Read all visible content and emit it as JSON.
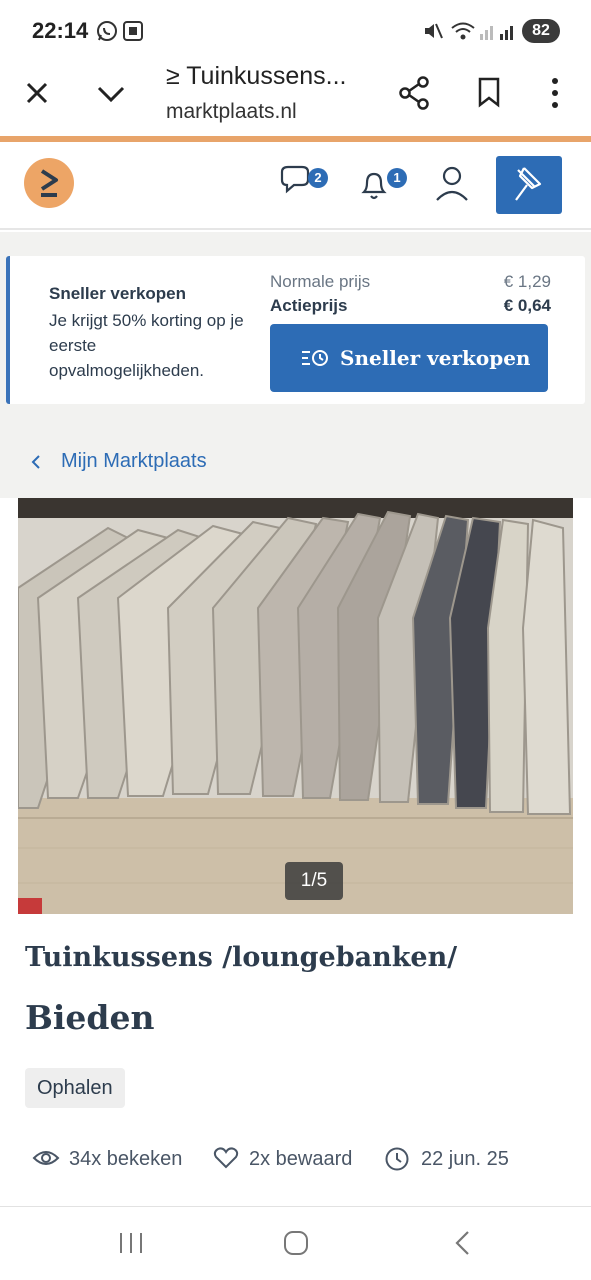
{
  "status_bar": {
    "time": "22:14",
    "battery": "82"
  },
  "browser": {
    "tab_title": "≥ Tuinkussens...",
    "url": "marktplaats.nl"
  },
  "header": {
    "messages_badge": "2",
    "notifications_badge": "1"
  },
  "promo": {
    "title": "Sneller verkopen",
    "description": "Je krijgt 50% korting op je eerste opvalmogelijkheden.",
    "normal_label": "Normale prijs",
    "normal_value": "€ 1,29",
    "action_label": "Actieprijs",
    "action_value": "€ 0,64",
    "button_label": "Sneller verkopen"
  },
  "nav": {
    "back_label": "Mijn Marktplaats"
  },
  "listing": {
    "image_counter": "1/5",
    "title": "Tuinkussens /loungebanken/",
    "price": "Bieden",
    "delivery_tag": "Ophalen"
  },
  "stats": {
    "views": "34x bekeken",
    "saved": "2x bewaard",
    "date": "22 jun. 25"
  },
  "colors": {
    "brand_blue": "#2d6cb5",
    "brand_orange": "#eda566",
    "text_dark": "#2d3c4d"
  }
}
